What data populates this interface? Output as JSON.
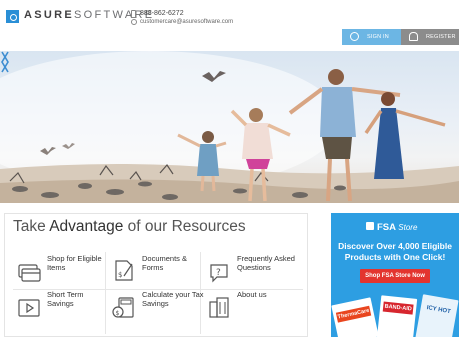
{
  "header": {
    "logo_bold": "ASURE",
    "logo_light": "SOFTWARE",
    "phone": "888-862-6272",
    "email": "customercare@asuresoftware.com"
  },
  "auth": {
    "signin_label": "SIGN IN",
    "register_label": "REGISTER"
  },
  "hero": {
    "prev_icon": "chevron-left-icon",
    "next_icon": "chevron-right-icon"
  },
  "resources": {
    "title_pre": "Take ",
    "title_bold": "Advantage",
    "title_post": " of our Resources",
    "items": [
      {
        "label": "Shop for Eligible Items",
        "icon": "credit-card-icon"
      },
      {
        "label": "Documents & Forms",
        "icon": "document-icon"
      },
      {
        "label": "Frequently Asked Questions",
        "icon": "question-bubble-icon"
      },
      {
        "label": "Short Term Savings",
        "icon": "video-player-icon"
      },
      {
        "label": "Calculate your Tax Savings",
        "icon": "calculator-icon"
      },
      {
        "label": "About us",
        "icon": "building-icon"
      }
    ]
  },
  "fsa_ad": {
    "brand": "FSA",
    "brand_suffix": "Store",
    "headline": "Discover Over 4,000 Eligible Products with One Click!",
    "button_label": "Shop FSA Store Now",
    "product_1": "ThermaCare",
    "product_2": "BAND-AID",
    "product_3": "ICY HOT"
  },
  "colors": {
    "accent_blue": "#2a8fd6",
    "signin_bg": "#6cb6e4",
    "register_bg": "#8c8c8c",
    "fsa_bg": "#2d9ee2",
    "fsa_button": "#e3342f"
  }
}
